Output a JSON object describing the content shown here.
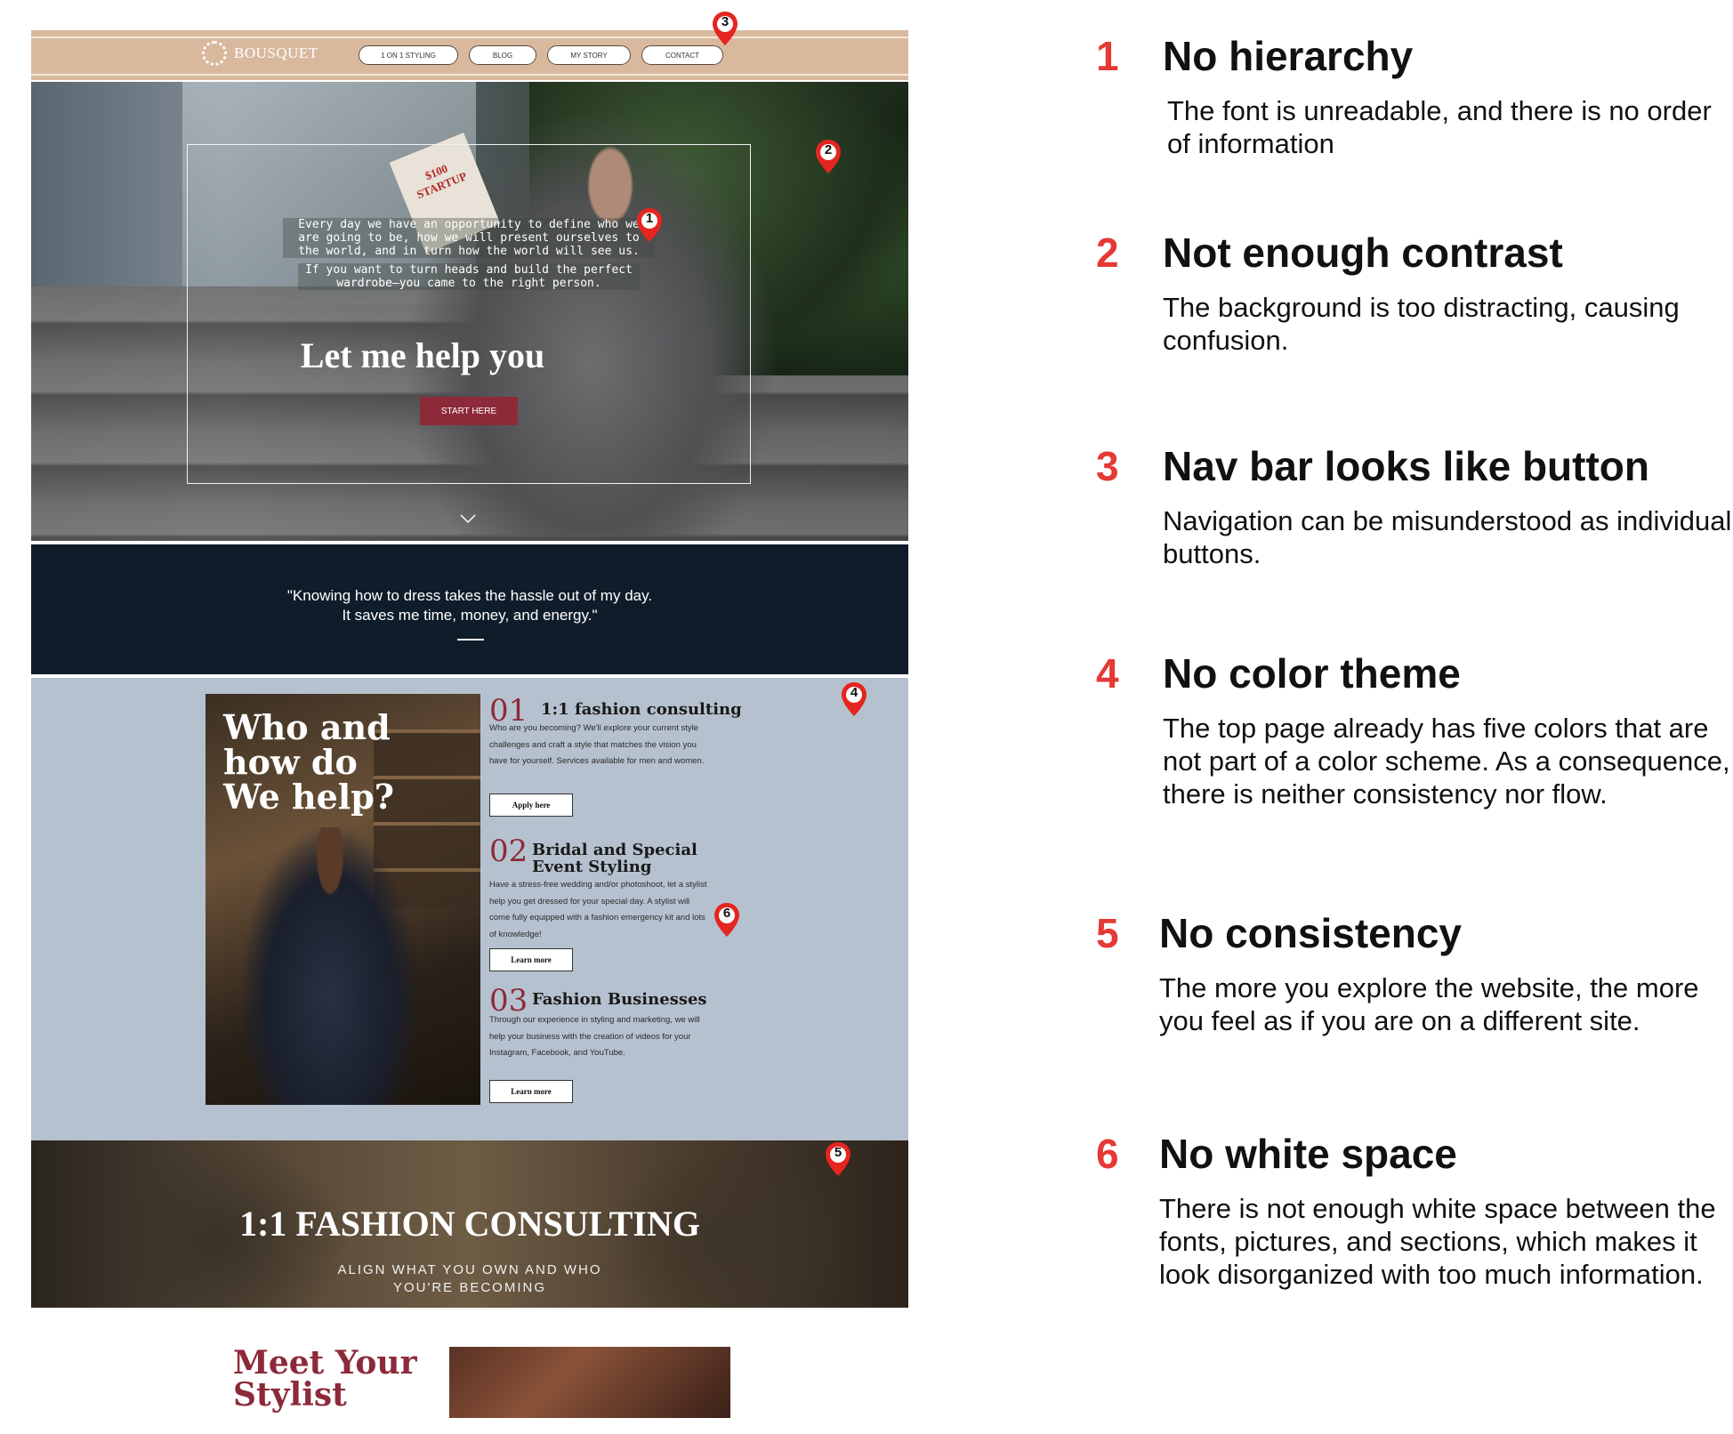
{
  "website": {
    "brand": "BOUSQUET",
    "nav": [
      {
        "label": "1 ON 1 STYLING"
      },
      {
        "label": "BLOG"
      },
      {
        "label": "MY STORY"
      },
      {
        "label": "CONTACT"
      }
    ],
    "hero": {
      "paragraph_1": [
        "Every day we have an opportunity to define who we",
        "are going to be, how we will present ourselves to",
        "the world, and in turn how the world will see us."
      ],
      "paragraph_2": [
        "If you want to turn heads and build the perfect",
        "wardrobe—you came to the right person."
      ],
      "heading": "Let me help you",
      "cta": "START HERE",
      "book_text": "$100 STARTUP"
    },
    "quote": {
      "line_1": "\"Knowing how to dress takes the hassle out of my day.",
      "line_2": "It saves me time, money, and energy.\""
    },
    "services": {
      "title": "Who and\nhow do\nWe help?",
      "items": [
        {
          "number": "01",
          "heading": "1:1 fashion consulting",
          "description": "Who are you becoming? We'll explore your current style challenges and craft a style that matches the vision you have for yourself. Services available for men and women.",
          "button": "Apply here"
        },
        {
          "number": "02",
          "heading": "Bridal and Special Event Styling",
          "description": "Have a stress-free wedding and/or photoshoot, let a stylist help you get dressed for your special day. A stylist will come fully equipped with a fashion emergency kit and lots of knowledge!",
          "button": "Learn more"
        },
        {
          "number": "03",
          "heading": "Fashion Businesses",
          "description": "Through our experience in styling and marketing, we will help your business with the creation of videos for your Instagram, Facebook, and YouTube.",
          "button": "Learn more"
        }
      ]
    },
    "consulting": {
      "heading": "1:1 FASHION CONSULTING",
      "sub_1": "ALIGN WHAT YOU OWN AND WHO",
      "sub_2": "YOU'RE BECOMING"
    },
    "meet": {
      "title_1": "Meet Your",
      "title_2": "Stylist"
    }
  },
  "pins": [
    {
      "label": "1"
    },
    {
      "label": "2"
    },
    {
      "label": "3"
    },
    {
      "label": "4"
    },
    {
      "label": "5"
    },
    {
      "label": "6"
    }
  ],
  "issues": [
    {
      "number": "1",
      "title": "No hierarchy",
      "description": "The font is unreadable, and there is no order of information"
    },
    {
      "number": "2",
      "title": "Not enough contrast",
      "description": "The background is too distracting, causing confusion."
    },
    {
      "number": "3",
      "title": "Nav bar looks like button",
      "description": "Navigation can be misunderstood as individual buttons."
    },
    {
      "number": "4",
      "title": "No color theme",
      "description": "The top page already has five colors that are not part of a color scheme. As a consequence, there is neither consistency nor flow."
    },
    {
      "number": "5",
      "title": "No consistency",
      "description": "The more you explore the website, the more you feel as if you are on a different site."
    },
    {
      "number": "6",
      "title": "No white space",
      "description": "There is not enough white space between the fonts, pictures, and sections, which makes it look disorganized with too much information."
    }
  ],
  "colors": {
    "issue_number": "#e53935",
    "nav_bg": "#d9b99e",
    "quote_bg": "#0f1d2a",
    "services_bg": "#b6c1cf",
    "accent_burgundy": "#8c2a3a",
    "pin": "#e52520"
  }
}
